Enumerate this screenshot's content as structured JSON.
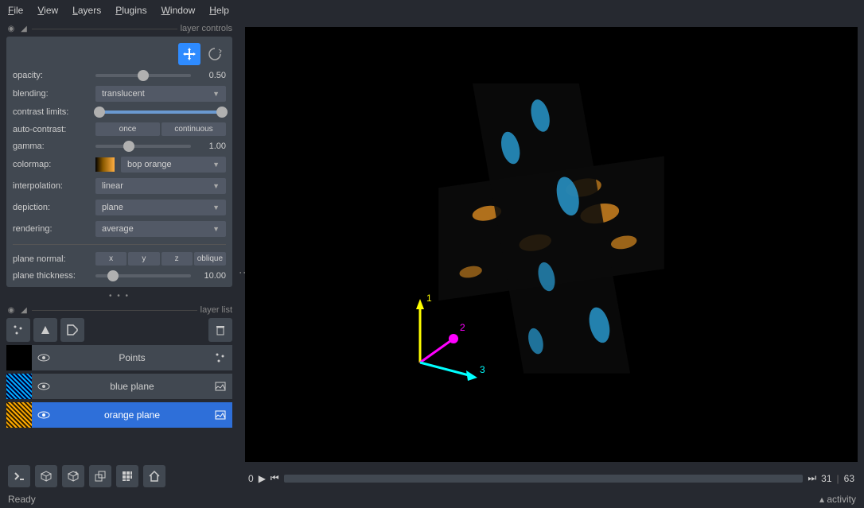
{
  "menu": {
    "file": "File",
    "view": "View",
    "layers": "Layers",
    "plugins": "Plugins",
    "window": "Window",
    "help": "Help"
  },
  "sections": {
    "layer_controls": "layer controls",
    "layer_list": "layer list"
  },
  "controls": {
    "opacity": {
      "label": "opacity:",
      "value": "0.50",
      "pct": 50
    },
    "blending": {
      "label": "blending:",
      "value": "translucent"
    },
    "contrast_limits": {
      "label": "contrast limits:",
      "low": 0,
      "high": 100
    },
    "auto_contrast": {
      "label": "auto-contrast:",
      "options": [
        "once",
        "continuous"
      ]
    },
    "gamma": {
      "label": "gamma:",
      "value": "1.00",
      "pct": 35
    },
    "colormap": {
      "label": "colormap:",
      "value": "bop orange"
    },
    "interpolation": {
      "label": "interpolation:",
      "value": "linear"
    },
    "depiction": {
      "label": "depiction:",
      "value": "plane"
    },
    "rendering": {
      "label": "rendering:",
      "value": "average"
    },
    "plane_normal": {
      "label": "plane normal:",
      "options": [
        "x",
        "y",
        "z",
        "oblique"
      ]
    },
    "plane_thickness": {
      "label": "plane thickness:",
      "value": "10.00",
      "pct": 18
    }
  },
  "layers": [
    {
      "name": "Points",
      "selected": false,
      "type": "points"
    },
    {
      "name": "blue plane",
      "selected": false,
      "type": "image"
    },
    {
      "name": "orange plane",
      "selected": true,
      "type": "image"
    }
  ],
  "axes": {
    "a1": "1",
    "a2": "2",
    "a3": "3"
  },
  "dim_slider": {
    "current": "0",
    "pos": "31",
    "max": "63"
  },
  "status": {
    "ready": "Ready",
    "activity": "activity"
  }
}
